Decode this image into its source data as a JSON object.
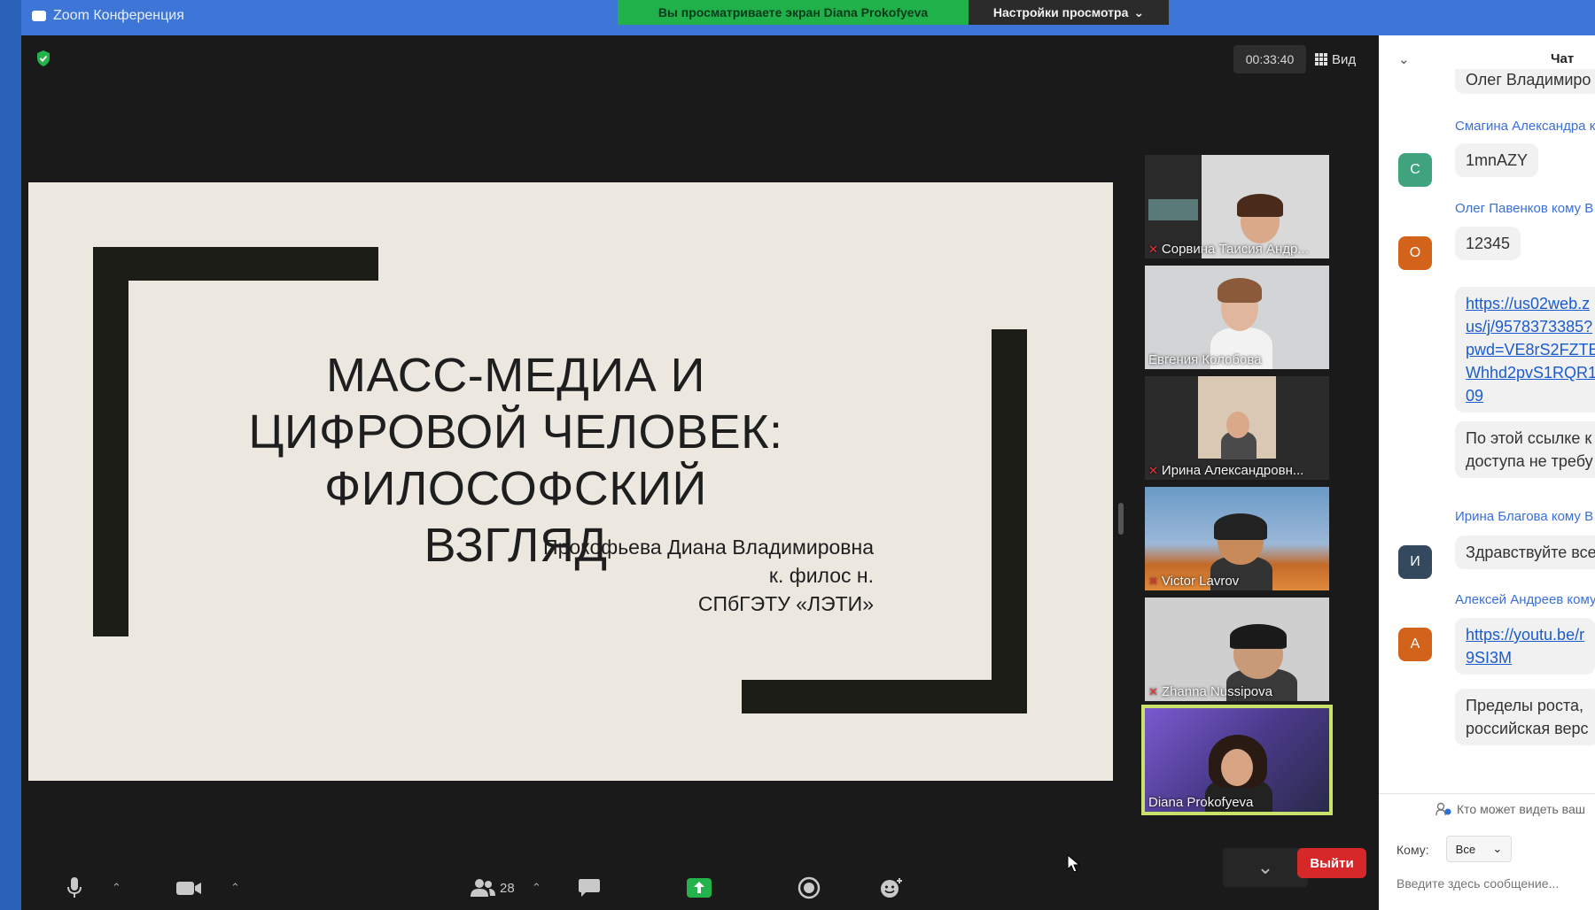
{
  "window": {
    "app_title": "Zoom Конференция",
    "share_banner": "Вы просматриваете экран Diana Prokofyeva",
    "view_settings": "Настройки просмотра",
    "view_settings_caret": "⌄"
  },
  "meeting": {
    "timer": "00:33:40",
    "view_label": "Вид"
  },
  "slide": {
    "title_lines": [
      "МАСС-МЕДИА И",
      "ЦИФРОВОЙ ЧЕЛОВЕК:",
      "ФИЛОСОФСКИЙ ВЗГЛЯД"
    ],
    "author_lines": [
      "Прокофьева Диана Владимировна",
      "к. филос н.",
      "СПбГЭТУ «ЛЭТИ»"
    ]
  },
  "participants": [
    {
      "name": "Сорвина Таисия Андр...",
      "muted": true
    },
    {
      "name": "Евгения Колобова",
      "muted": false
    },
    {
      "name": "Ирина Александровн...",
      "muted": true
    },
    {
      "name": "Victor Lavrov",
      "muted": true
    },
    {
      "name": "Zhanna Nussipova",
      "muted": true
    },
    {
      "name": "Diana Prokofyeva",
      "muted": false,
      "active": true
    }
  ],
  "toolbar": {
    "participants_count": "28",
    "leave_label": "Выйти"
  },
  "chat": {
    "title": "Чат",
    "messages": [
      {
        "text": "Олег Владимиро"
      },
      {
        "sender": "Смагина Александра к",
        "avatar": "С",
        "avatar_color": "#3fa47e",
        "text": "1mnAZY"
      },
      {
        "sender": "Олег Павенков кому В",
        "avatar": "О",
        "avatar_color": "#d3631a",
        "text": "12345"
      },
      {
        "link_lines": [
          "https://us02web.z",
          "us/j/9578373385?",
          "pwd=VE8rS2FZTE",
          "Whhd2pvS1RQR1",
          "09"
        ]
      },
      {
        "text_lines": [
          "По этой ссылке к",
          "доступа не требу"
        ]
      },
      {
        "sender": "Ирина Благова кому В",
        "avatar": "И",
        "avatar_color": "#34495e",
        "text": "Здравствуйте все"
      },
      {
        "sender": "Алексей Андреев кому",
        "avatar": "А",
        "avatar_color": "#d3631a",
        "link_lines": [
          "https://youtu.be/r",
          "9SI3M"
        ]
      },
      {
        "text_lines": [
          "Пределы роста,",
          "российская верс"
        ]
      }
    ],
    "who_sees": "Кто может видеть ваш",
    "to_label": "Кому:",
    "to_value": "Все",
    "input_placeholder": "Введите здесь сообщение..."
  }
}
